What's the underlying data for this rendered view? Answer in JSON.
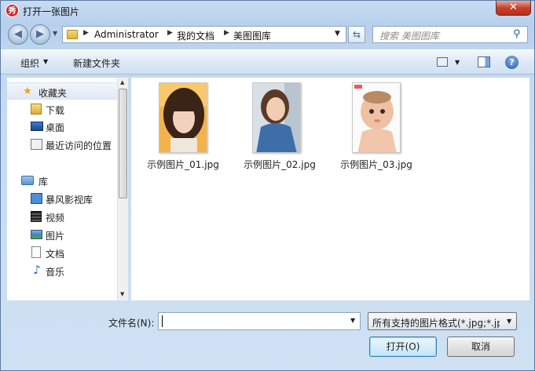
{
  "window": {
    "title": "打开一张图片",
    "app_icon_char": "秀",
    "close_symbol": "✕"
  },
  "navigation": {
    "back_symbol": "◀",
    "forward_symbol": "▶",
    "breadcrumb": [
      "Administrator",
      "我的文档",
      "美图图库"
    ],
    "search_placeholder": "搜索 美图图库"
  },
  "toolbar": {
    "organize_label": "组织",
    "new_folder_label": "新建文件夹",
    "help_symbol": "?"
  },
  "sidebar": {
    "favorites_label": "收藏夹",
    "favorites": [
      "下载",
      "桌面",
      "最近访问的位置"
    ],
    "libraries_label": "库",
    "libraries": [
      "暴风影视库",
      "视频",
      "图片",
      "文档",
      "音乐"
    ]
  },
  "files": [
    {
      "name": "示例图片_01.jpg",
      "icon": "photo-woman-bangs"
    },
    {
      "name": "示例图片_02.jpg",
      "icon": "photo-woman-denim"
    },
    {
      "name": "示例图片_03.jpg",
      "icon": "photo-baby"
    }
  ],
  "bottom": {
    "filename_label": "文件名(N):",
    "filename_value": "",
    "filetype_value": "所有支持的图片格式(*.jpg;*.jp",
    "open_label": "打开(O)",
    "cancel_label": "取消"
  },
  "colors": {
    "window_frame": "#b7d0ec",
    "close_button": "#c7432f",
    "selection": "#e0e9f4"
  }
}
